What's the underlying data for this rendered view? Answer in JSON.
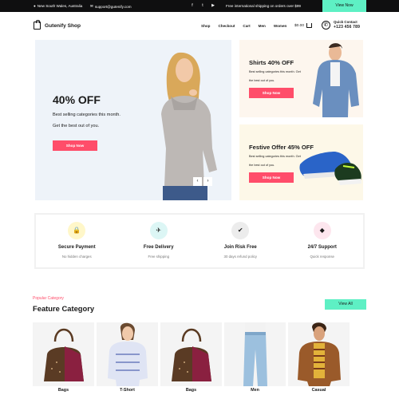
{
  "topbar": {
    "location": "New South Wales, Australia",
    "email": "support@gutenify.com",
    "promo": "Free international shipping on orders over $99",
    "view_now": "View Now",
    "socials": [
      "facebook-icon",
      "twitter-icon",
      "youtube-icon"
    ]
  },
  "header": {
    "logo": "Gutenify Shop",
    "nav": [
      "Shop",
      "Checkout",
      "Cart",
      "Men",
      "Women"
    ],
    "cart_total": "$0.00",
    "contact_label": "Quick Contact",
    "contact_phone": "+123 456 789"
  },
  "hero": {
    "title": "40% OFF",
    "line1": "Best selling categories this month.",
    "line2": "Get the best out of you.",
    "button": "Shop Now",
    "prev": "‹",
    "next": "›"
  },
  "promo_cards": [
    {
      "title": "Shirts 40% OFF",
      "line1": "Best selling categories this month. Get",
      "line2": "the best out of you.",
      "button": "Shop Now"
    },
    {
      "title": "Festive Offer 45% OFF",
      "line1": "Best selling categories this month. Get",
      "line2": "the best out of you.",
      "button": "Shop Now"
    }
  ],
  "features": [
    {
      "title": "Secure Payment",
      "sub": "No hidden charges",
      "icon": "lock-icon",
      "color": "#fff7c9"
    },
    {
      "title": "Free Delivery",
      "sub": "Free shipping",
      "icon": "plane-icon",
      "color": "#dcf6f5"
    },
    {
      "title": "Join Risk Free",
      "sub": "30 days refund policy",
      "icon": "check-icon",
      "color": "#ececec"
    },
    {
      "title": "24/7 Support",
      "sub": "Quick response",
      "icon": "diamond-icon",
      "color": "#fde6ee"
    }
  ],
  "category": {
    "kicker": "Popular Category",
    "title": "Feature Category",
    "view_all": "View All",
    "items": [
      "Bags",
      "T-Short",
      "Bags",
      "Men",
      "Casual"
    ]
  },
  "colors": {
    "accent_red": "#ff4d6a",
    "accent_mint": "#5ef0c4",
    "topbar": "#0f0f10"
  }
}
